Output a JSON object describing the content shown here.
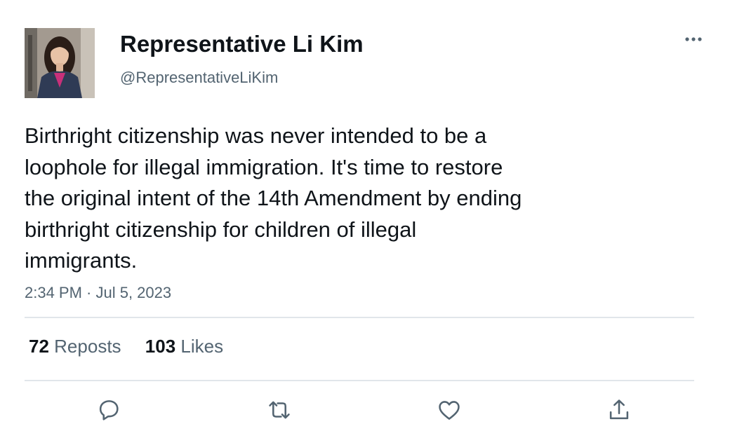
{
  "author": {
    "display_name": "Representative Li Kim",
    "handle": "@RepresentativeLiKim",
    "avatar_icon": "avatar-photo"
  },
  "tweet": {
    "lines": [
      "Birthright citizenship was never intended to be a",
      "loophole for illegal immigration. It's time to restore",
      "the original intent of the 14th Amendment by ending",
      "birthright citizenship for children of illegal",
      "immigrants."
    ],
    "timestamp": "2:34 PM · Jul 5, 2023"
  },
  "stats": {
    "reposts_count": "72",
    "reposts_label": "Reposts",
    "likes_count": "103",
    "likes_label": "Likes"
  },
  "actions": [
    {
      "icon": "reply-icon"
    },
    {
      "icon": "repost-icon"
    },
    {
      "icon": "like-icon"
    },
    {
      "icon": "share-icon"
    }
  ],
  "colors": {
    "primary_text": "#0f1419",
    "secondary_text": "#536471",
    "divider": "#e1e6ea",
    "icon": "#536471"
  }
}
